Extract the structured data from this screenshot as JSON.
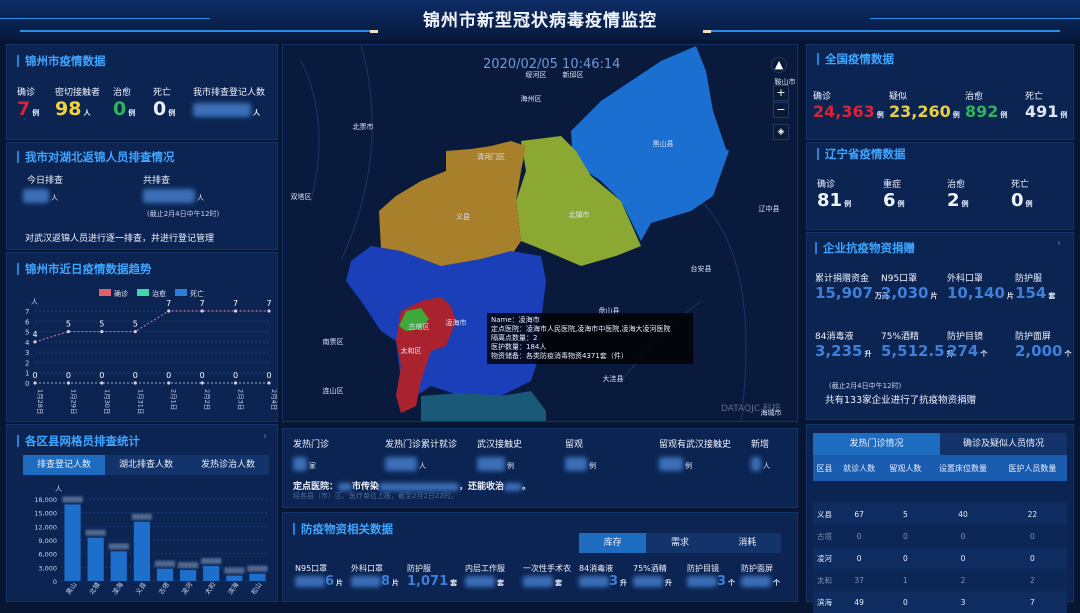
{
  "header": {
    "title": "锦州市新型冠状病毒疫情监控"
  },
  "jinzhou": {
    "title": "锦州市疫情数据",
    "stats": [
      {
        "label": "确诊",
        "value": "7",
        "unit": "例",
        "color": "#d8233a"
      },
      {
        "label": "密切接触者",
        "value": "98",
        "unit": "人",
        "color": "#f1d33b"
      },
      {
        "label": "治愈",
        "value": "0",
        "unit": "例",
        "color": "#2fb35a"
      },
      {
        "label": "死亡",
        "value": "0",
        "unit": "例",
        "color": "#e8eefc"
      },
      {
        "label": "我市排查登记人数",
        "value": null,
        "unit": "人"
      }
    ]
  },
  "hubei": {
    "title": "我市对湖北返锦人员排查情况",
    "today_label": "今日排查",
    "today_unit": "人",
    "total_label": "共排查",
    "total_unit": "人",
    "note": "(截止2月4日中午12时)",
    "desc": "对武汉返锦人员进行逐一排查，并进行登记管理"
  },
  "trend": {
    "title": "锦州市近日疫情数据趋势"
  },
  "chart_data": [
    {
      "type": "line",
      "title": "锦州市近日疫情数据趋势",
      "ylabel": "人",
      "ylim": [
        0,
        7
      ],
      "grid": true,
      "legend_position": "top",
      "categories": [
        "1月28日",
        "1月29日",
        "1月30日",
        "1月31日",
        "2月1日",
        "2月2日",
        "2月3日",
        "2月4日"
      ],
      "series": [
        {
          "name": "确诊",
          "color": "#e06070",
          "values": [
            4,
            5,
            5,
            5,
            7,
            7,
            7,
            7
          ]
        },
        {
          "name": "治愈",
          "color": "#3fd6b0",
          "values": [
            0,
            0,
            0,
            0,
            0,
            0,
            0,
            0
          ]
        },
        {
          "name": "死亡",
          "color": "#2a7fd6",
          "values": [
            0,
            0,
            0,
            0,
            0,
            0,
            0,
            0
          ]
        }
      ]
    },
    {
      "type": "bar",
      "title": "各区县网格员排查统计",
      "ylabel": "人",
      "ylim": [
        0,
        18000
      ],
      "grid": true,
      "yticks": [
        0,
        3000,
        6000,
        9000,
        12000,
        15000,
        18000
      ],
      "categories": [
        "黑山",
        "北镇",
        "凌海",
        "义县",
        "古塔",
        "凌河",
        "太和",
        "滨海",
        "松山"
      ],
      "values": [
        16800,
        9500,
        6500,
        13000,
        2700,
        2400,
        3300,
        1200,
        1600
      ]
    }
  ],
  "grid": {
    "title": "各区县网格员排查统计",
    "tabs": [
      "排查登记人数",
      "湖北排查人数",
      "发热诊治人数"
    ],
    "active": 0
  },
  "map": {
    "timestamp": "2020/02/05 10:46:14",
    "watermark": "DATAQJC 科技",
    "labels": [
      "绥河区",
      "新邱区",
      "海州区",
      "北票市",
      "清河门区",
      "双塔区",
      "义县",
      "北镇市",
      "黑山县",
      "辽中县",
      "台安县",
      "南票区",
      "连山区",
      "古塔区",
      "凌海市",
      "太和区",
      "盘山县",
      "大洼县",
      "海城市",
      "鞍山市"
    ],
    "tooltip": [
      "Name：凌海市",
      "定点医院：凌海市人民医院,凌海市中医院,凌海大凌河医院",
      "隔离点数量：2",
      "医护数量：184人",
      "物资储备：各类防疫消毒物资4371套（件）"
    ],
    "controls": {
      "zoom_in": "+",
      "zoom_out": "−"
    }
  },
  "clinic": {
    "cols": [
      {
        "label": "发热门诊",
        "unit": "家"
      },
      {
        "label": "发热门诊累计就诊",
        "unit": "人"
      },
      {
        "label": "武汉接触史",
        "unit": "例"
      },
      {
        "label": "留观",
        "unit": "例"
      },
      {
        "label": "留观有武汉接触史",
        "unit": "例"
      },
      {
        "label": "新增",
        "unit": "人"
      }
    ],
    "hospital_prefix": "定点医院：",
    "hospital_mid": "市传染",
    "hospital_suffix": "，还能收治",
    "source": "经各县（市）区、医疗单位上报，截至2月2日22时。"
  },
  "supplies": {
    "title": "防疫物资相关数据",
    "tabs": [
      "库存",
      "需求",
      "消耗"
    ],
    "active": 0,
    "items": [
      {
        "label": "N95口罩",
        "value": "6",
        "unit": "片"
      },
      {
        "label": "外科口罩",
        "value": "8",
        "unit": "片"
      },
      {
        "label": "防护服",
        "value": "1,071",
        "unit": "套"
      },
      {
        "label": "内层工作服",
        "value": "",
        "unit": "套"
      },
      {
        "label": "一次性手术衣",
        "value": "",
        "unit": "套"
      },
      {
        "label": "84消毒液",
        "value": "3",
        "unit": "升"
      },
      {
        "label": "75%酒精",
        "value": "",
        "unit": "升"
      },
      {
        "label": "防护目镜",
        "value": "3",
        "unit": "个"
      },
      {
        "label": "防护面屏",
        "value": "",
        "unit": "个"
      }
    ]
  },
  "national": {
    "title": "全国疫情数据",
    "stats": [
      {
        "label": "确诊",
        "value": "24,363",
        "unit": "例",
        "color": "#d8233a"
      },
      {
        "label": "疑似",
        "value": "23,260",
        "unit": "例",
        "color": "#e8d040"
      },
      {
        "label": "治愈",
        "value": "892",
        "unit": "例",
        "color": "#2fb35a"
      },
      {
        "label": "死亡",
        "value": "491",
        "unit": "例",
        "color": "#dfe6f2"
      }
    ]
  },
  "liaoning": {
    "title": "辽宁省疫情数据",
    "stats": [
      {
        "label": "确诊",
        "value": "81",
        "unit": "例"
      },
      {
        "label": "重症",
        "value": "6",
        "unit": "例"
      },
      {
        "label": "治愈",
        "value": "2",
        "unit": "例"
      },
      {
        "label": "死亡",
        "value": "0",
        "unit": "例"
      }
    ]
  },
  "donation": {
    "title": "企业抗疫物资捐赠",
    "items": [
      {
        "label": "累计捐赠资金",
        "value": "15,907",
        "unit": "万元"
      },
      {
        "label": "N95口罩",
        "value": "2,030",
        "unit": "片"
      },
      {
        "label": "外科口罩",
        "value": "10,140",
        "unit": "片"
      },
      {
        "label": "防护服",
        "value": "154",
        "unit": "套"
      },
      {
        "label": "84消毒液",
        "value": "3,235",
        "unit": "升"
      },
      {
        "label": "75%酒精",
        "value": "5,512.5",
        "unit": "升"
      },
      {
        "label": "防护目镜",
        "value": "274",
        "unit": "个"
      },
      {
        "label": "防护面屏",
        "value": "2,000",
        "unit": "个"
      }
    ],
    "note": "(截止2月4日中午12时)",
    "summary": "共有133家企业进行了抗疫物资捐赠"
  },
  "fever": {
    "tabs": [
      "发热门诊情况",
      "确诊及疑似人员情况"
    ],
    "active": 0,
    "headers": [
      "区县",
      "就诊人数",
      "留观人数",
      "设置床位数量",
      "医护人员数量"
    ],
    "rows": [
      [
        "义县",
        "67",
        "5",
        "40",
        "22"
      ],
      [
        "古塔",
        "0",
        "0",
        "0",
        "0"
      ],
      [
        "凌河",
        "0",
        "0",
        "0",
        "0"
      ],
      [
        "太和",
        "37",
        "1",
        "2",
        "2"
      ],
      [
        "滨海",
        "49",
        "0",
        "3",
        "7"
      ]
    ]
  }
}
